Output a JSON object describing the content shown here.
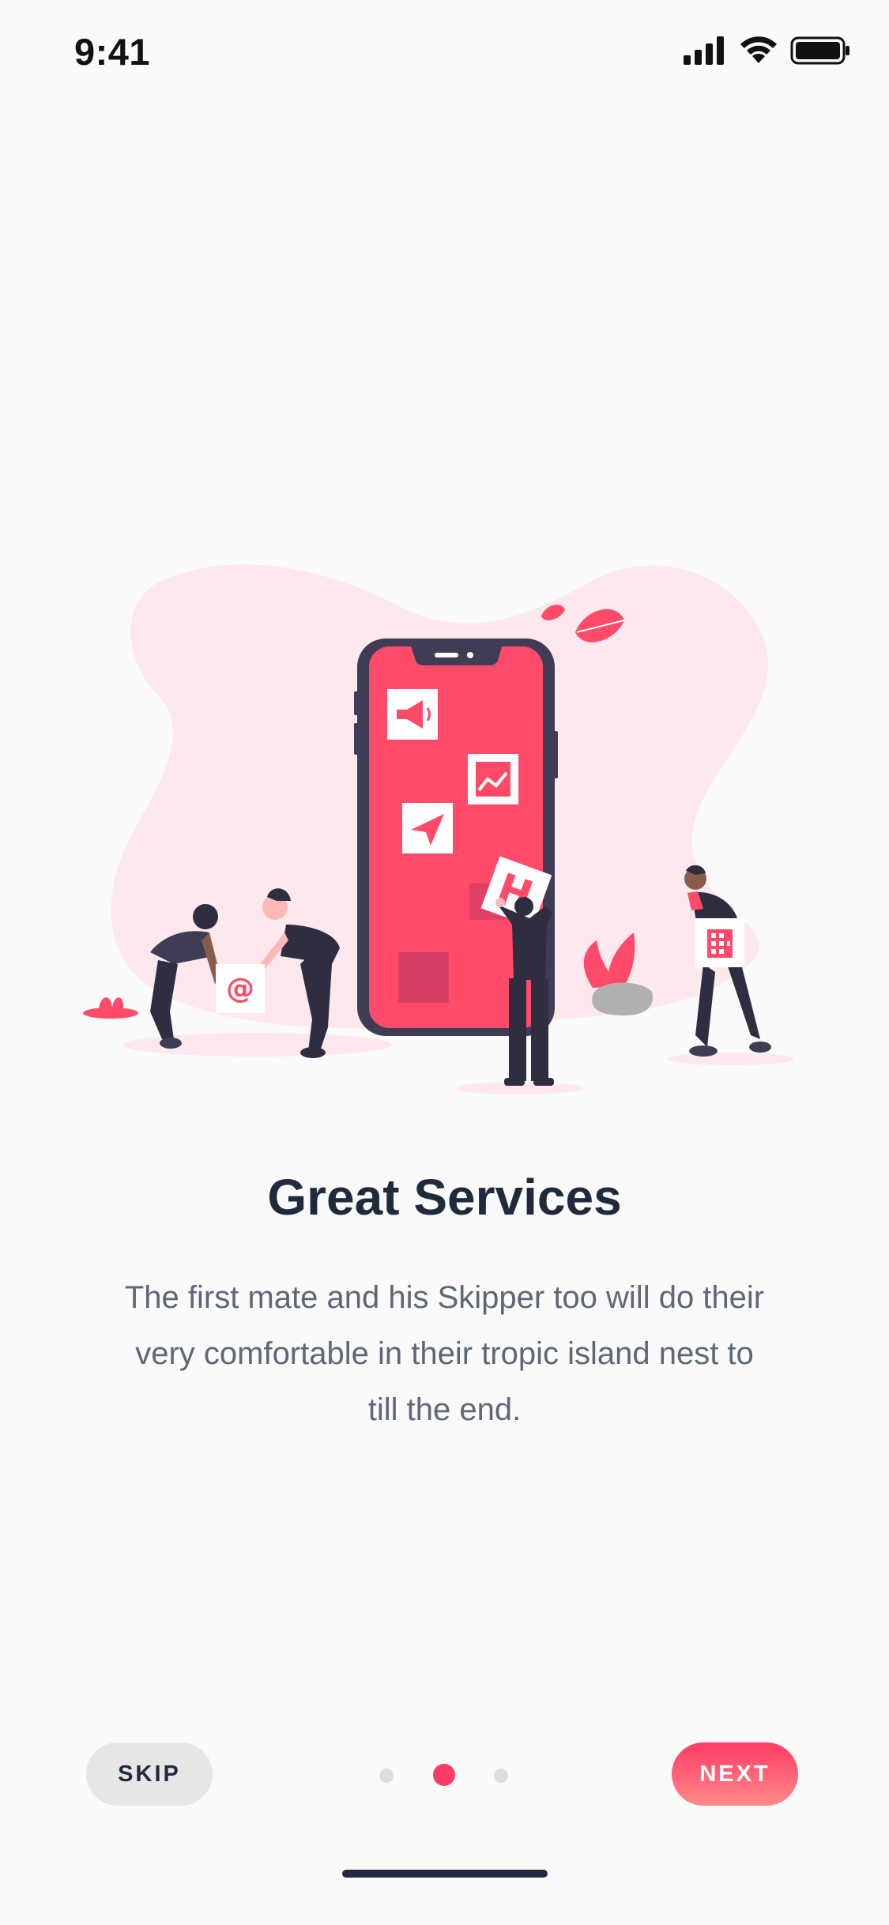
{
  "status_bar": {
    "time": "9:41",
    "icons": [
      "cellular-signal-icon",
      "wifi-icon",
      "battery-icon"
    ]
  },
  "illustration": {
    "name": "team-building-app-illustration",
    "icons": [
      "megaphone-icon",
      "chart-icon",
      "paper-plane-icon",
      "at-sign-icon",
      "building-icon"
    ],
    "colors": {
      "accent": "#ff4a6a",
      "phone_body": "#3f3d56",
      "blob": "#fce8ed",
      "figure_dark": "#2f2e41"
    }
  },
  "onboarding": {
    "title": "Great Services",
    "description": "The first mate and his Skipper too will do their very comfortable in their tropic island nest to till the end."
  },
  "controls": {
    "skip_label": "SKIP",
    "next_label": "NEXT",
    "page_count": 3,
    "active_page": 2
  },
  "colors": {
    "accent": "#ff3c65",
    "accent_gradient_end": "#ff8a8a",
    "title": "#1f2b3d",
    "body_text": "#5d6778",
    "skip_bg": "#e6e6e6",
    "dot_inactive": "#dedede",
    "background": "#fafafa"
  }
}
